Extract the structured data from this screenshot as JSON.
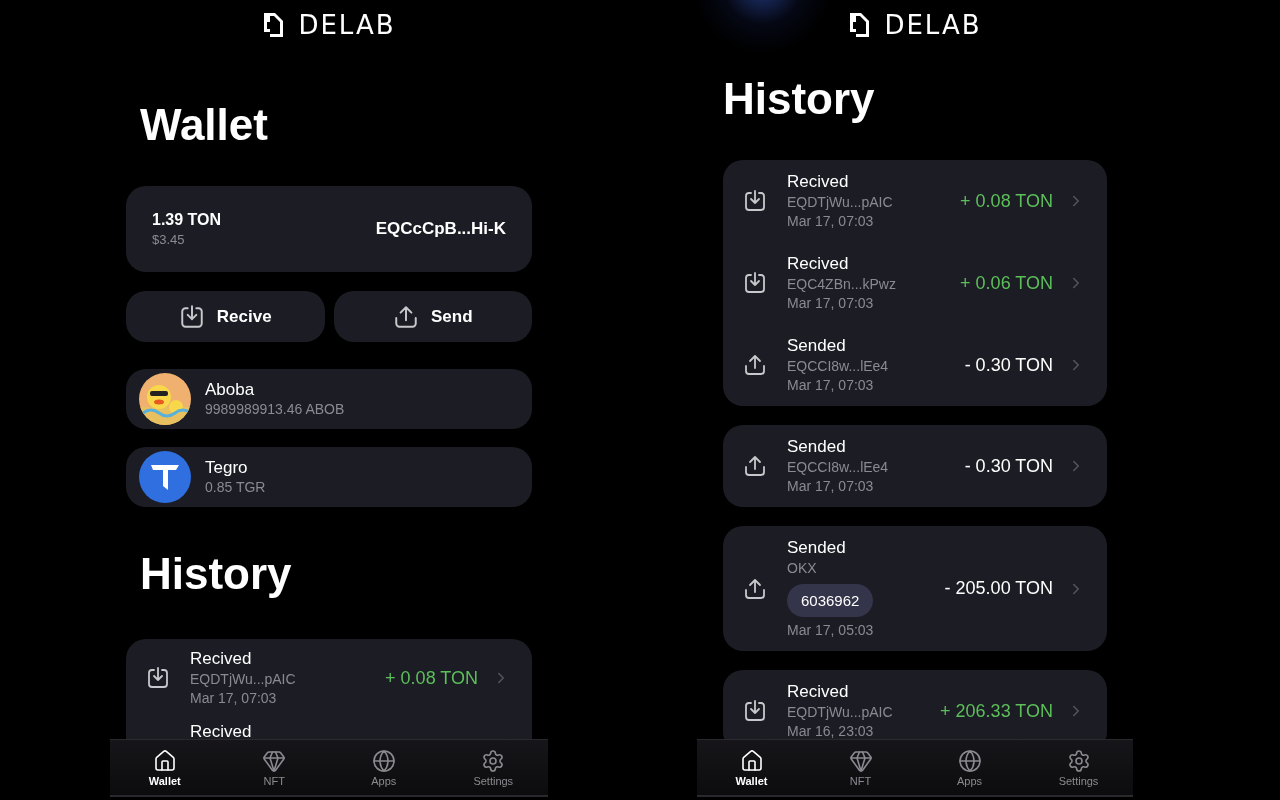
{
  "wallet_screen": {
    "logo": "DELAB",
    "title": "Wallet",
    "balance": {
      "amount": "1.39 TON",
      "fiat": "$3.45",
      "address": "EQCcCpB...Hi-K"
    },
    "actions": [
      {
        "kind": "receive",
        "label": "Recive"
      },
      {
        "kind": "send",
        "label": "Send"
      }
    ],
    "tokens": [
      {
        "kind": "picture",
        "name": "Aboba",
        "balance": "9989989913.46 ABOB"
      },
      {
        "kind": "logo",
        "name": "Tegro",
        "balance": "0.85 TGR"
      }
    ],
    "section_title": "History",
    "history": [
      {
        "items": [
          {
            "kind": "received",
            "title": "Recived",
            "address": "EQDTjWu...pAIC",
            "date": "Mar 17, 07:03",
            "amount": "+ 0.08 TON"
          },
          {
            "kind": "received",
            "title": "Recived"
          }
        ]
      }
    ],
    "tab_bar": [
      {
        "kind": "home",
        "label": "Wallet",
        "selected": true
      },
      {
        "kind": "gem",
        "label": "NFT",
        "selected": false
      },
      {
        "kind": "globe",
        "label": "Apps",
        "selected": false
      },
      {
        "kind": "gear",
        "label": "Settings",
        "selected": false
      }
    ]
  },
  "history_screen": {
    "logo": "DELAB",
    "title": "History",
    "history": [
      {
        "items": [
          {
            "kind": "received",
            "title": "Recived",
            "address": "EQDTjWu...pAIC",
            "date": "Mar 17, 07:03",
            "amount": "+ 0.08 TON"
          },
          {
            "kind": "received",
            "title": "Recived",
            "address": "EQC4ZBn...kPwz",
            "date": "Mar 17, 07:03",
            "amount": "+ 0.06 TON"
          },
          {
            "kind": "sent",
            "title": "Sended",
            "address": "EQCCI8w...lEe4",
            "date": "Mar 17, 07:03",
            "amount": "- 0.30 TON"
          }
        ]
      },
      {
        "items": [
          {
            "kind": "sent",
            "title": "Sended",
            "address": "EQCCI8w...lEe4",
            "date": "Mar 17, 07:03",
            "amount": "- 0.30 TON"
          }
        ]
      },
      {
        "items": [
          {
            "kind": "sent",
            "title": "Sended",
            "address": "OKX",
            "memo": "6036962",
            "date": "Mar 17, 05:03",
            "amount": "- 205.00 TON"
          }
        ]
      },
      {
        "items": [
          {
            "kind": "received",
            "title": "Recived",
            "address": "EQDTjWu...pAIC",
            "date": "Mar 16, 23:03",
            "amount": "+ 206.33 TON"
          }
        ]
      }
    ],
    "tab_bar": [
      {
        "kind": "home",
        "label": "Wallet",
        "selected": true
      },
      {
        "kind": "gem",
        "label": "NFT",
        "selected": false
      },
      {
        "kind": "globe",
        "label": "Apps",
        "selected": false
      },
      {
        "kind": "gear",
        "label": "Settings",
        "selected": false
      }
    ]
  }
}
